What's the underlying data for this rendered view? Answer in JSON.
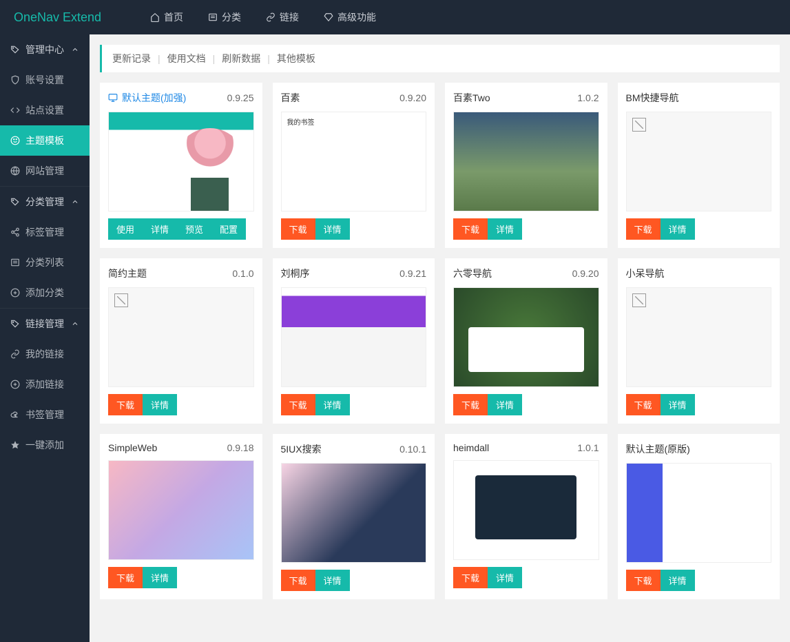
{
  "logo": "OneNav Extend",
  "topnav": [
    {
      "label": "首页",
      "icon": "home"
    },
    {
      "label": "分类",
      "icon": "list"
    },
    {
      "label": "链接",
      "icon": "link"
    },
    {
      "label": "高级功能",
      "icon": "diamond"
    }
  ],
  "sidebar": {
    "groups": [
      {
        "label": "管理中心",
        "icon": "tag",
        "open": true,
        "items": [
          {
            "label": "账号设置",
            "icon": "shield"
          },
          {
            "label": "站点设置",
            "icon": "code"
          },
          {
            "label": "主题模板",
            "icon": "smile",
            "active": true
          },
          {
            "label": "网站管理",
            "icon": "globe"
          }
        ]
      },
      {
        "label": "分类管理",
        "icon": "tag",
        "open": true,
        "items": [
          {
            "label": "标签管理",
            "icon": "share"
          },
          {
            "label": "分类列表",
            "icon": "list"
          },
          {
            "label": "添加分类",
            "icon": "plus"
          }
        ]
      },
      {
        "label": "链接管理",
        "icon": "tag",
        "open": true,
        "items": [
          {
            "label": "我的链接",
            "icon": "link"
          },
          {
            "label": "添加链接",
            "icon": "plus"
          },
          {
            "label": "书签管理",
            "icon": "cloud"
          },
          {
            "label": "一键添加",
            "icon": "star"
          }
        ]
      }
    ]
  },
  "tabs": [
    "更新记录",
    "使用文档",
    "刷新数据",
    "其他模板"
  ],
  "themes": [
    {
      "title": "默认主题(加强)",
      "version": "0.9.25",
      "current": true,
      "thumb": "t-anime",
      "buttons": [
        "使用",
        "详情",
        "预览",
        "配置"
      ],
      "btnTypes": [
        "green",
        "green",
        "green",
        "green"
      ]
    },
    {
      "title": "百素",
      "version": "0.9.20",
      "thumb": "t-white",
      "buttons": [
        "下载",
        "详情"
      ],
      "btnTypes": [
        "orange",
        "green"
      ]
    },
    {
      "title": "百素Two",
      "version": "1.0.2",
      "thumb": "t-landscape",
      "buttons": [
        "下载",
        "详情"
      ],
      "btnTypes": [
        "orange",
        "green"
      ]
    },
    {
      "title": "BM快捷导航",
      "version": "",
      "thumb": "broken",
      "buttons": [
        "下载",
        "详情"
      ],
      "btnTypes": [
        "orange",
        "green"
      ]
    },
    {
      "title": "简约主题",
      "version": "0.1.0",
      "thumb": "broken",
      "buttons": [
        "下载",
        "详情"
      ],
      "btnTypes": [
        "orange",
        "green"
      ]
    },
    {
      "title": "刘桐序",
      "version": "0.9.21",
      "thumb": "t-purple",
      "buttons": [
        "下载",
        "详情"
      ],
      "btnTypes": [
        "orange",
        "green"
      ]
    },
    {
      "title": "六零导航",
      "version": "0.9.20",
      "thumb": "t-nature",
      "buttons": [
        "下载",
        "详情"
      ],
      "btnTypes": [
        "orange",
        "green"
      ]
    },
    {
      "title": "小呆导航",
      "version": "",
      "thumb": "broken",
      "buttons": [
        "下载",
        "详情"
      ],
      "btnTypes": [
        "orange",
        "green"
      ]
    },
    {
      "title": "SimpleWeb",
      "version": "0.9.18",
      "thumb": "t-animegrp",
      "buttons": [
        "下载",
        "详情"
      ],
      "btnTypes": [
        "orange",
        "green"
      ]
    },
    {
      "title": "5IUX搜索",
      "version": "0.10.1",
      "thumb": "t-sakura",
      "buttons": [
        "下载",
        "详情"
      ],
      "btnTypes": [
        "orange",
        "green"
      ]
    },
    {
      "title": "heimdall",
      "version": "1.0.1",
      "thumb": "t-devices",
      "buttons": [
        "下载",
        "详情"
      ],
      "btnTypes": [
        "orange",
        "green"
      ]
    },
    {
      "title": "默认主题(原版)",
      "version": "",
      "thumb": "t-default",
      "buttons": [
        "下载",
        "详情"
      ],
      "btnTypes": [
        "orange",
        "green"
      ]
    }
  ],
  "icons": {
    "home": "⌂",
    "list": "▤",
    "link": "🔗",
    "diamond": "◈",
    "tag": "🏷",
    "shield": "🛡",
    "code": "</>",
    "smile": "☺",
    "globe": "🌐",
    "share": "<",
    "plus": "⊕",
    "cloud": "☁",
    "star": "★",
    "monitor": "🖥"
  }
}
